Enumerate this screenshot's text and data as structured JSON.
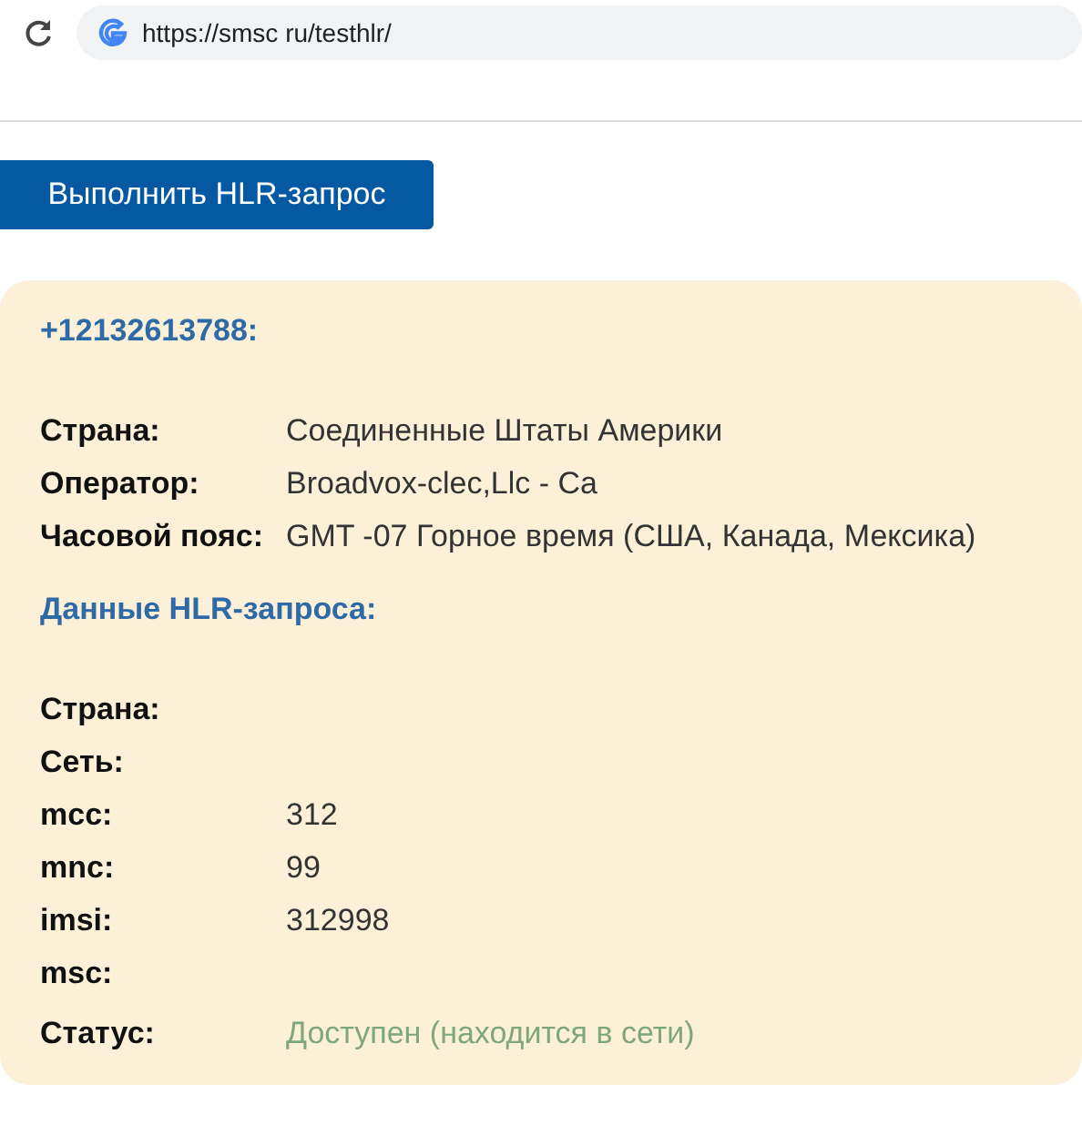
{
  "browser": {
    "url": "https://smsc ru/testhlr/"
  },
  "button": "Выполнить HLR-запрос",
  "card": {
    "title": "+12132613788:",
    "info": [
      {
        "label": "Страна:",
        "value": "Соединенные Штаты Америки"
      },
      {
        "label": "Оператор:",
        "value": "Broadvox-clec,Llc - Ca"
      },
      {
        "label": "Часовой пояс:",
        "value": "GMT -07 Горное время (США, Канада, Мексика)"
      }
    ],
    "hlr_title": "Данные HLR-запроса:",
    "hlr": [
      {
        "label": "Страна:",
        "kind": "plain"
      },
      {
        "label": "Сеть:",
        "kind": "plain"
      },
      {
        "label": "mcc:",
        "value": "312",
        "kind": "plain"
      },
      {
        "label": "mnc:",
        "value": "99",
        "kind": "plain"
      },
      {
        "label": "imsi:",
        "value": "312998",
        "kind": "plain"
      },
      {
        "label": "msc:",
        "kind": "plain"
      },
      {
        "label": "Статус:",
        "value": "Доступен (находится в сети)",
        "kind": "status"
      }
    ]
  }
}
